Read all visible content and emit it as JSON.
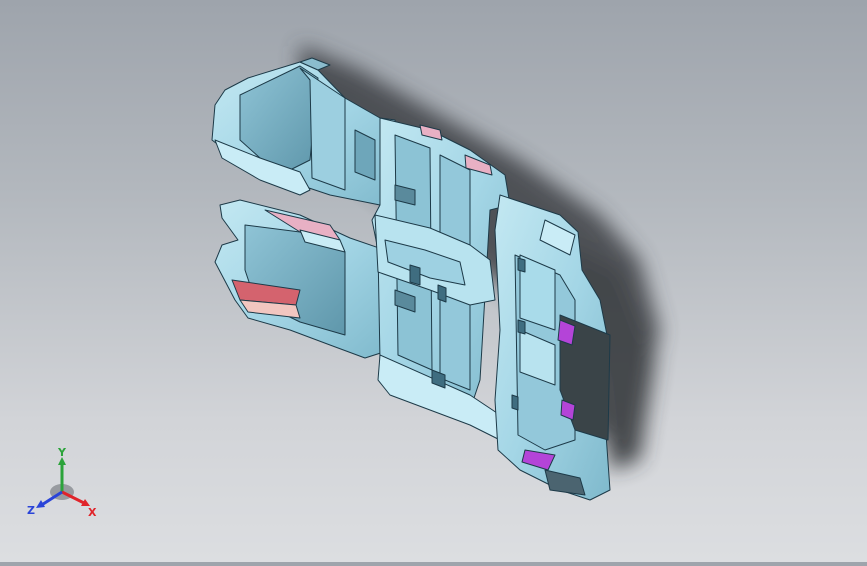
{
  "viewport": {
    "background_top": "#9ea4ac",
    "background_bottom": "#dcdee1",
    "part_color": "#a4d6e6",
    "part_dark": "#7fb9cc",
    "part_edge": "#1d3a48",
    "shadow_color": "#3c3f44",
    "highlight_pink": "#e8b0c4",
    "highlight_red": "#d4636e",
    "highlight_purple": "#b444d8"
  },
  "triad": {
    "x_label": "X",
    "y_label": "Y",
    "z_label": "Z",
    "x_color": "#e0242a",
    "y_color": "#2ba33a",
    "z_color": "#2a44d8"
  }
}
